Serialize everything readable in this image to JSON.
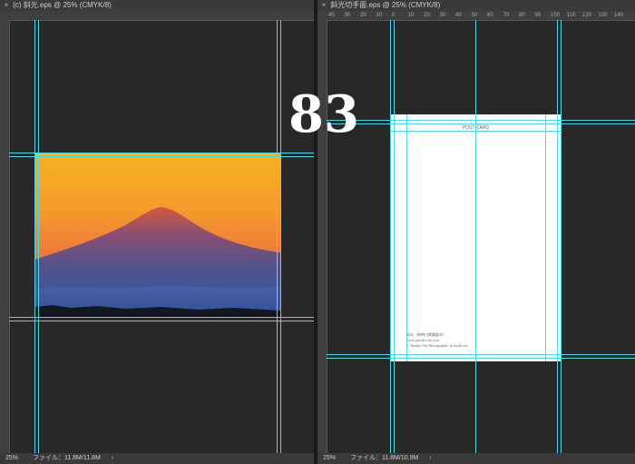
{
  "left_document": {
    "tab_title": "(c) 斜光.eps @ 25% (CMYK/8)",
    "status_zoom": "25%",
    "status_file": "ファイル：11.8M/11.8M",
    "status_arrow": "›"
  },
  "right_document": {
    "tab_title": "斜光切手面.eps @ 25% (CMYK/8)",
    "status_zoom": "25%",
    "status_file": "ファイル：11.8M/10.9M",
    "status_arrow": "›",
    "ruler_numbers": [
      "40",
      "30",
      "20",
      "10",
      "0",
      "10",
      "20",
      "30",
      "40",
      "50",
      "60",
      "70",
      "80",
      "90",
      "100",
      "110",
      "120",
      "130",
      "140"
    ],
    "card_label": "POST CARD",
    "card_credit_line1": "斜光（神奈川県鎌倉市）",
    "card_credit_line2": "www.yumiko-ota.com",
    "card_credit_line3": "© Yumiko Ota Photographer, in Zushi city"
  },
  "page_number": "83",
  "colors": {
    "guide": "#4fd6e0",
    "workspace": "#282828"
  },
  "icons": {
    "close": "×"
  }
}
